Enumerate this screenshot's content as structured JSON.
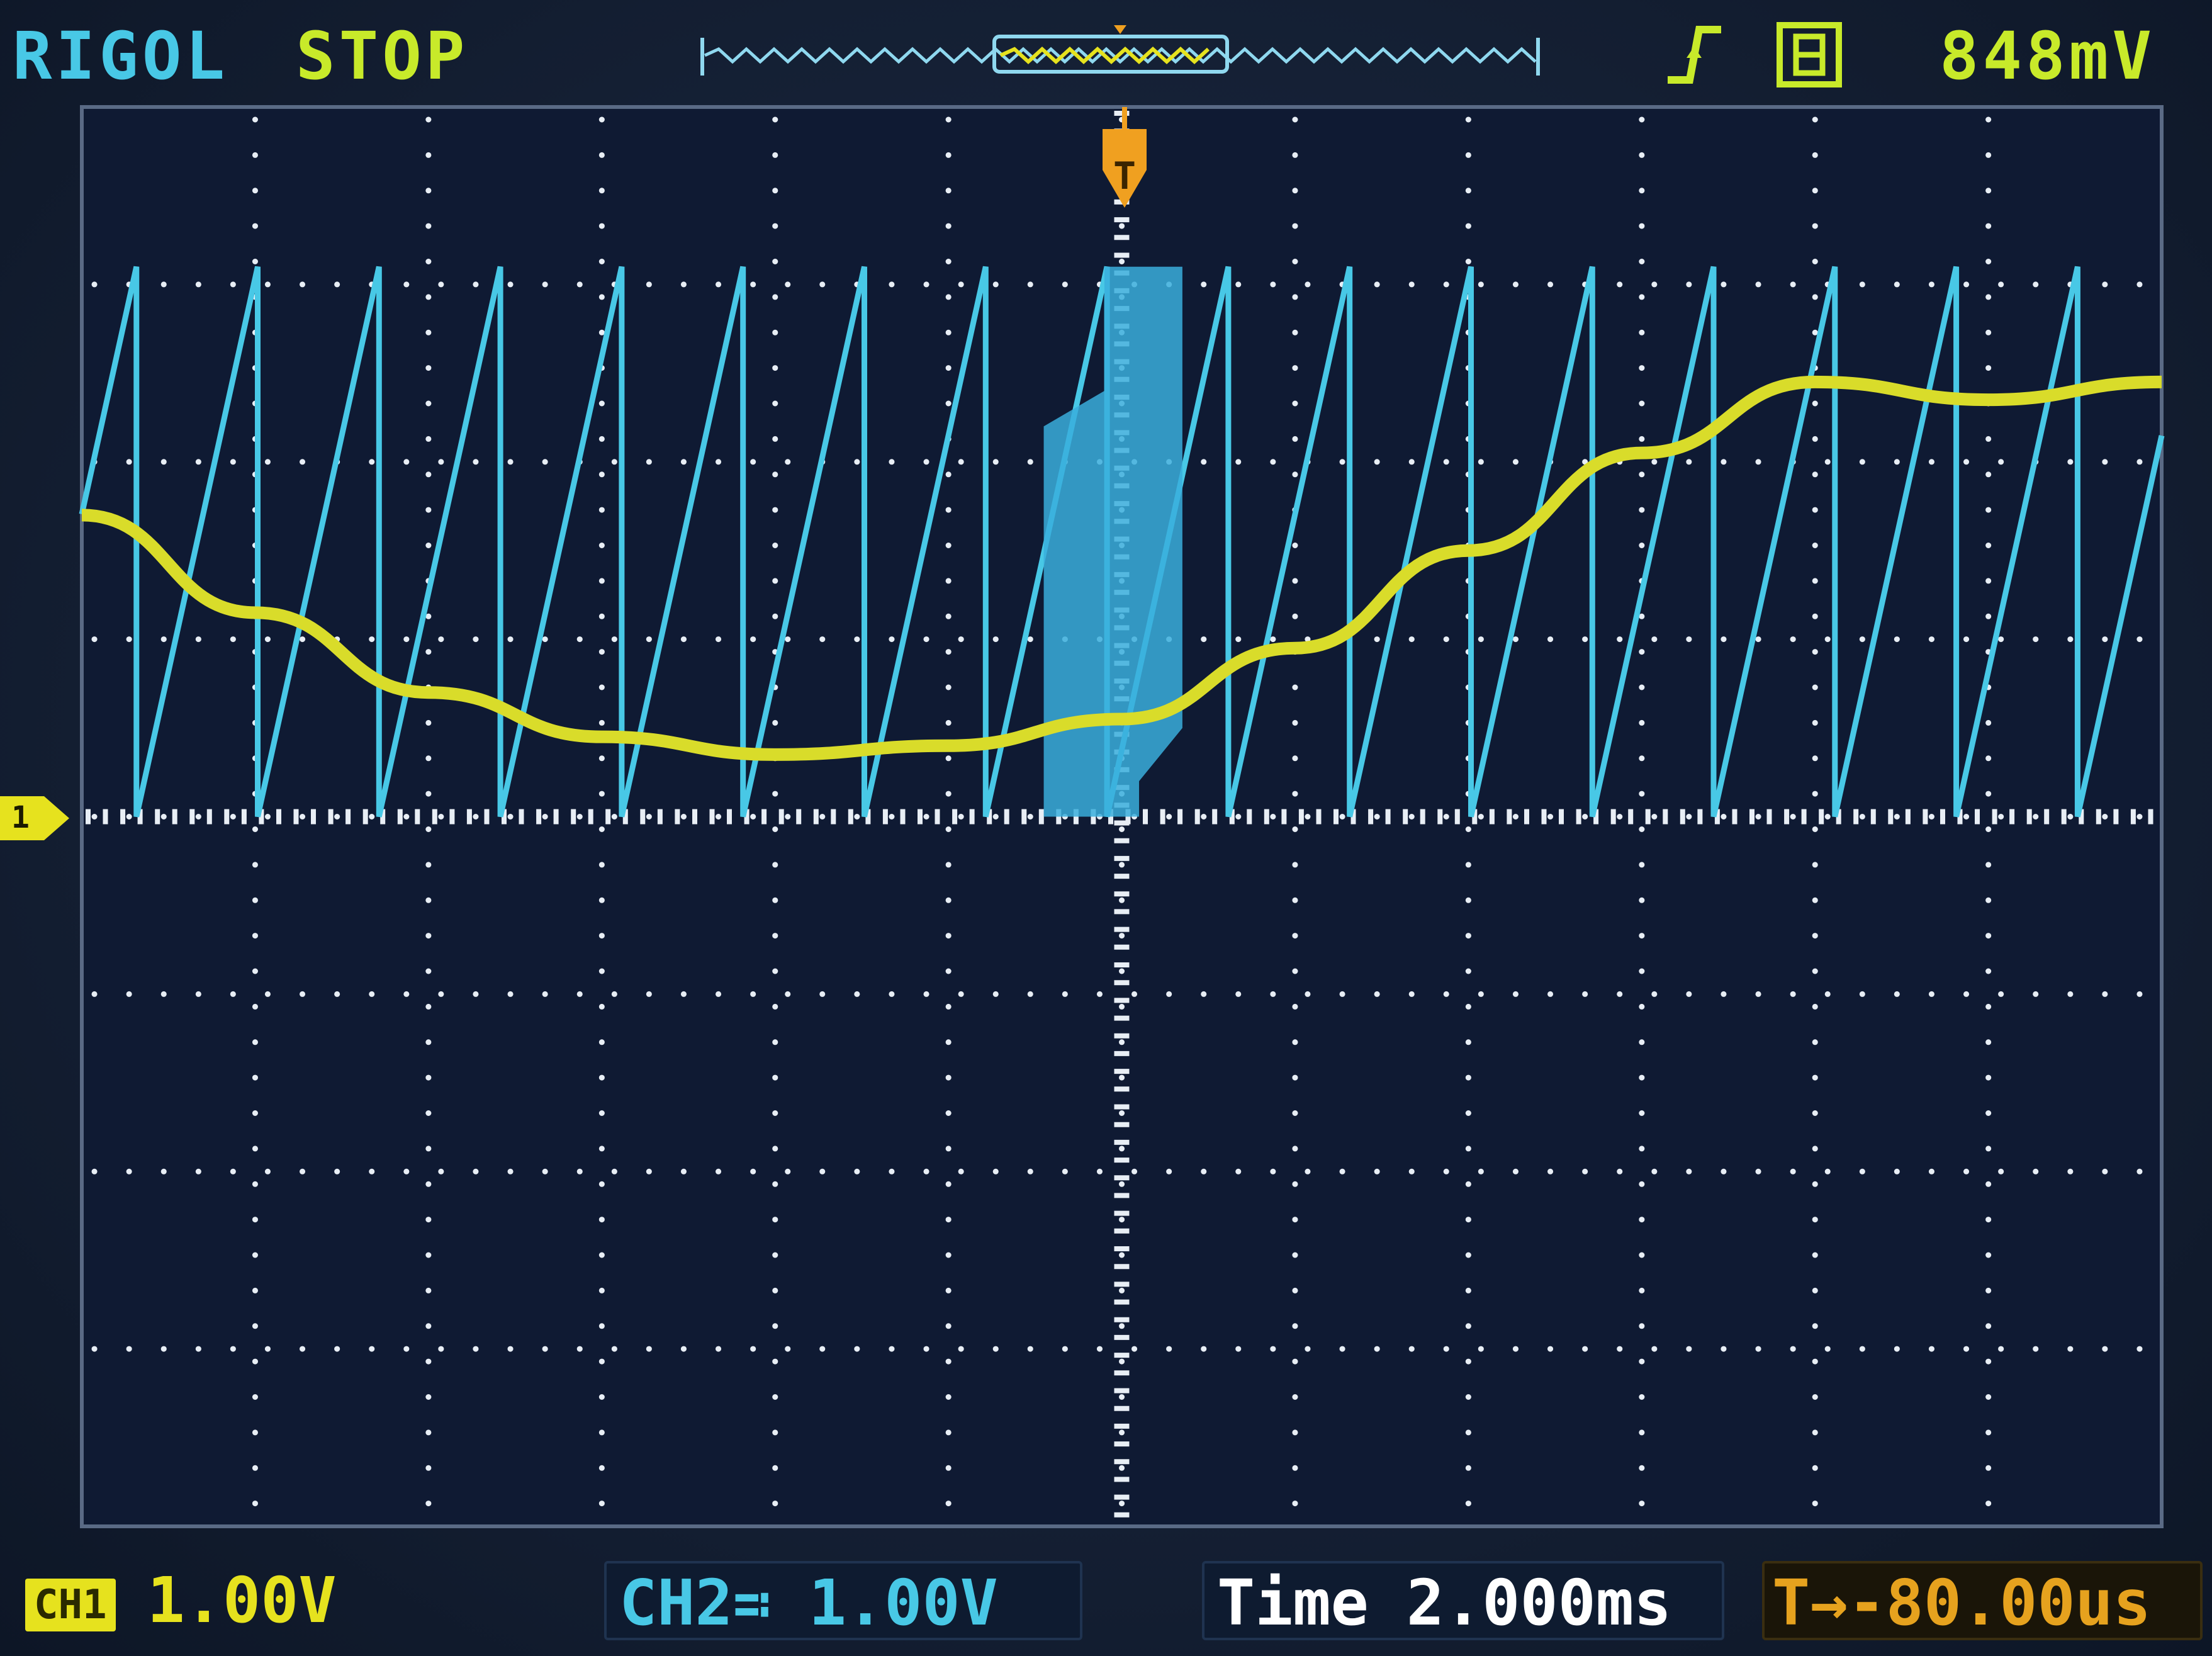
{
  "header": {
    "brand": "RIGOL",
    "run_state": "STOP",
    "trigger_level": "848mV",
    "trigger_edge_icon": "rising-edge-icon",
    "coupling_icon": "dc-coupling-icon"
  },
  "footer": {
    "ch1_tag": "CH1",
    "ch1_scale": "1.00V",
    "ch2_label": "CH2",
    "ch2_coupling_symbol": "≕",
    "ch2_scale": "1.00V",
    "time_label": "Time",
    "time_scale": "2.000ms",
    "trigger_offset_icon": "T",
    "trigger_offset": "→-80.00us"
  },
  "markers": {
    "ch1_ground_label": "1"
  },
  "colors": {
    "ch1": "#e6e21e",
    "ch2": "#48c8e6",
    "trigger": "#f0a020",
    "grid": "#e8eef5",
    "screen": "#0f1a33"
  },
  "chart_data": {
    "type": "line",
    "grid_divisions": {
      "x": 12,
      "y": 8
    },
    "series": [
      {
        "name": "CH1",
        "x_div": [
          -6,
          -5,
          -4,
          -3,
          -2,
          -1,
          0,
          1,
          2,
          3,
          4,
          5,
          6
        ],
        "y_div": [
          1.7,
          1.15,
          0.7,
          0.45,
          0.35,
          0.4,
          0.55,
          0.95,
          1.5,
          2.05,
          2.45,
          2.35,
          2.45
        ]
      },
      {
        "name": "CH2",
        "shape": "sawtooth",
        "period_div": 0.7,
        "min_div": 0,
        "max_div": 3.1
      }
    ]
  }
}
